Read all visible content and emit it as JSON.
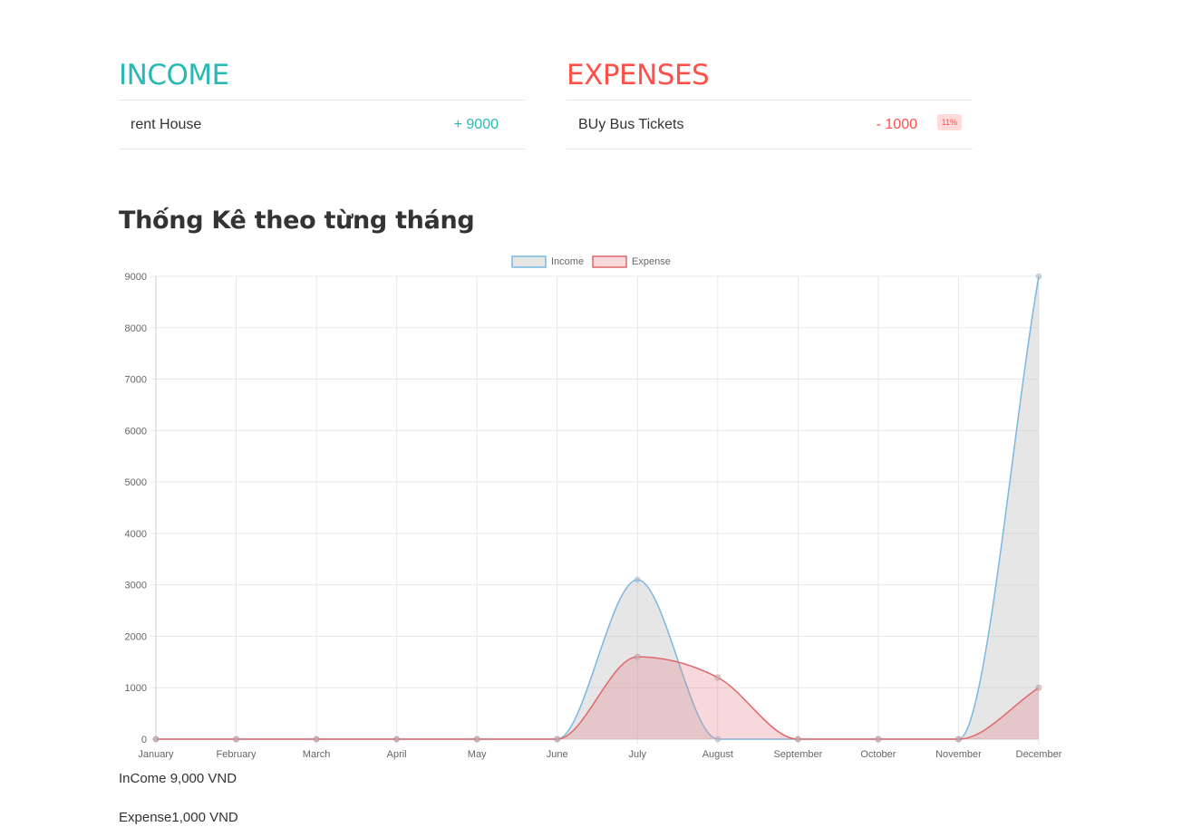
{
  "income": {
    "title": "INCOME",
    "items": [
      {
        "description": "rent House",
        "value": "+ 9000"
      }
    ]
  },
  "expenses": {
    "title": "EXPENSES",
    "items": [
      {
        "description": "BUy Bus Tickets",
        "value": "- 1000",
        "percentage": "11%"
      }
    ]
  },
  "stats_title": "Thống Kê theo từng tháng",
  "summary": {
    "income_label": "InCome 9,000 VND",
    "expense_label": "Expense1,000 VND"
  },
  "colors": {
    "income_accent": "#28b9b5",
    "expense_accent": "#ff5049",
    "income_line": "#7ab8e0",
    "expense_line": "#e0676b"
  },
  "chart_data": {
    "type": "area",
    "categories": [
      "January",
      "February",
      "March",
      "April",
      "May",
      "June",
      "July",
      "August",
      "September",
      "October",
      "November",
      "December"
    ],
    "series": [
      {
        "name": "Income",
        "values": [
          0,
          0,
          0,
          0,
          0,
          0,
          3100,
          0,
          0,
          0,
          0,
          9000
        ]
      },
      {
        "name": "Expense",
        "values": [
          0,
          0,
          0,
          0,
          0,
          0,
          1600,
          1200,
          0,
          0,
          0,
          1000
        ]
      }
    ],
    "ylim": [
      0,
      9000
    ],
    "yticks": [
      0,
      1000,
      2000,
      3000,
      4000,
      5000,
      6000,
      7000,
      8000,
      9000
    ],
    "grid": true,
    "legend_position": "top"
  }
}
